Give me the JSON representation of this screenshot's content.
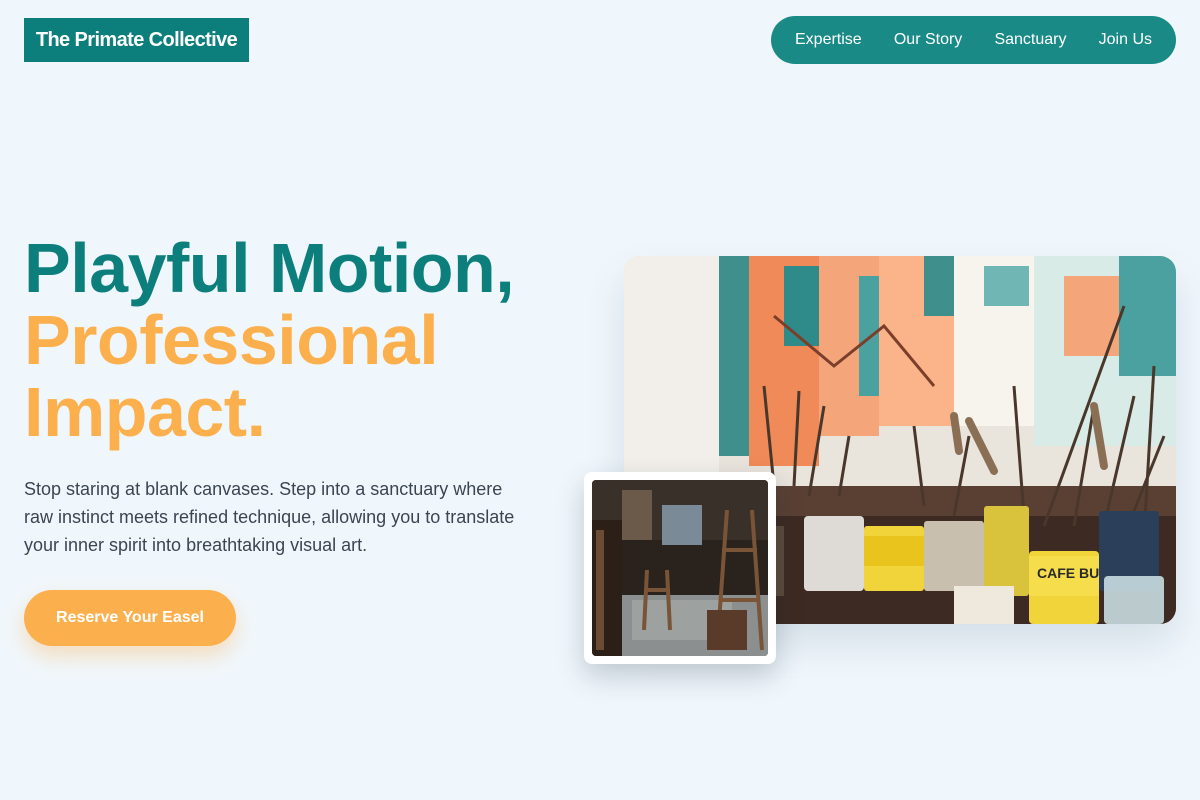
{
  "brand": {
    "name": "The Primate Collective"
  },
  "nav": {
    "items": [
      {
        "label": "Expertise"
      },
      {
        "label": "Our Story"
      },
      {
        "label": "Sanctuary"
      },
      {
        "label": "Join Us"
      }
    ]
  },
  "hero": {
    "headline_line1": "Playful Motion,",
    "headline_line2": "Professional",
    "headline_line3": "Impact.",
    "description": "Stop staring at blank canvases. Step into a sanctuary where raw instinct meets refined technique, allowing you to translate your inner spirit into breathtaking visual art.",
    "cta_label": "Reserve Your Easel"
  },
  "images": {
    "main_photo_label": "CAFE BUSTELO",
    "main_photo": "art studio table with paint cans and brushes",
    "inset_photo": "cluttered artist studio interior with wooden easels"
  },
  "colors": {
    "background": "#f0f7fc",
    "primary_teal": "#0c7f7c",
    "nav_teal": "#1a8a87",
    "accent_orange": "#fcb04d",
    "body_text": "#3b4552"
  }
}
